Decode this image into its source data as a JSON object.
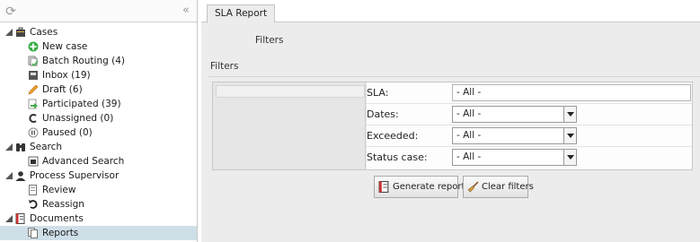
{
  "sidebar": {
    "tree": [
      {
        "label": "Cases",
        "level": 0,
        "expandable": true,
        "icon": "briefcase-icon"
      },
      {
        "label": "New case",
        "level": 1,
        "icon": "plus-icon"
      },
      {
        "label": "Batch Routing (4)",
        "level": 1,
        "icon": "batch-icon"
      },
      {
        "label": "Inbox (19)",
        "level": 1,
        "icon": "inbox-icon"
      },
      {
        "label": "Draft (6)",
        "level": 1,
        "icon": "pencil-icon"
      },
      {
        "label": "Participated (39)",
        "level": 1,
        "icon": "arrow-icon"
      },
      {
        "label": "Unassigned (0)",
        "level": 1,
        "icon": "unassigned-icon"
      },
      {
        "label": "Paused (0)",
        "level": 1,
        "icon": "pause-icon"
      },
      {
        "label": "Search",
        "level": 0,
        "expandable": true,
        "icon": "binoculars-icon"
      },
      {
        "label": "Advanced Search",
        "level": 1,
        "icon": "advanced-search-icon"
      },
      {
        "label": "Process Supervisor",
        "level": 0,
        "expandable": true,
        "icon": "user-icon"
      },
      {
        "label": "Review",
        "level": 1,
        "icon": "review-icon"
      },
      {
        "label": "Reassign",
        "level": 1,
        "icon": "reassign-icon"
      },
      {
        "label": "Documents",
        "level": 0,
        "expandable": true,
        "icon": "documents-icon"
      },
      {
        "label": "Reports",
        "level": 1,
        "icon": "reports-icon",
        "selected": true
      }
    ]
  },
  "tab": {
    "label": "SLA Report"
  },
  "main": {
    "filters_caption": "Filters",
    "filters_title": "Filters",
    "filters": [
      {
        "label": "SLA:",
        "value": "- All -",
        "kind": "input"
      },
      {
        "label": "Dates:",
        "value": "- All -",
        "kind": "select"
      },
      {
        "label": "Exceeded:",
        "value": "- All -",
        "kind": "select"
      },
      {
        "label": "Status case:",
        "value": "- All -",
        "kind": "select"
      }
    ],
    "generate_label": "Generate report",
    "clear_label": "Clear filters"
  },
  "colors": {
    "selected_row": "#cfdfe8",
    "panel_bg": "#ececec",
    "new_case_green": "#3fae49",
    "draft_orange": "#f0a030"
  }
}
